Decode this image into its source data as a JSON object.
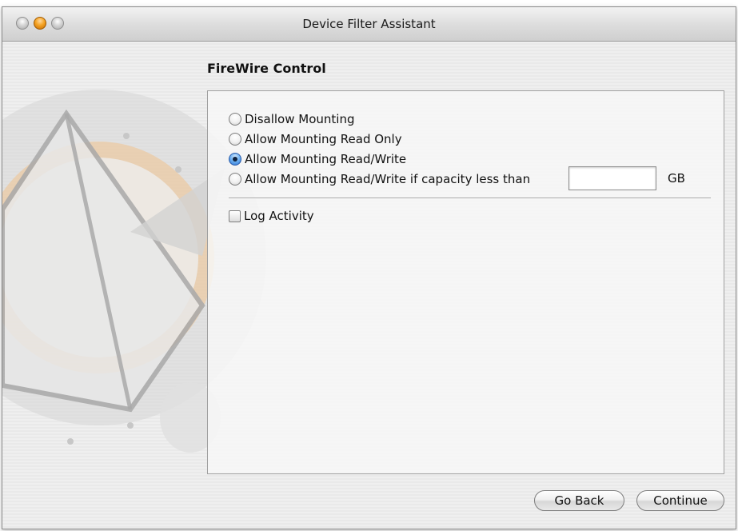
{
  "window": {
    "title": "Device Filter Assistant"
  },
  "page": {
    "heading": "FireWire Control"
  },
  "mounting_options": [
    {
      "label": "Disallow Mounting",
      "selected": false
    },
    {
      "label": "Allow Mounting Read Only",
      "selected": false
    },
    {
      "label": "Allow Mounting Read/Write",
      "selected": true
    },
    {
      "label": "Allow Mounting Read/Write if capacity less than",
      "selected": false
    }
  ],
  "capacity": {
    "value": "",
    "unit_label": "GB"
  },
  "log_activity": {
    "label": "Log Activity",
    "checked": false
  },
  "buttons": {
    "back_label": "Go Back",
    "continue_label": "Continue"
  },
  "colors": {
    "minimize_button": "#f5a425",
    "selected_radio": "#2a6fd0"
  }
}
